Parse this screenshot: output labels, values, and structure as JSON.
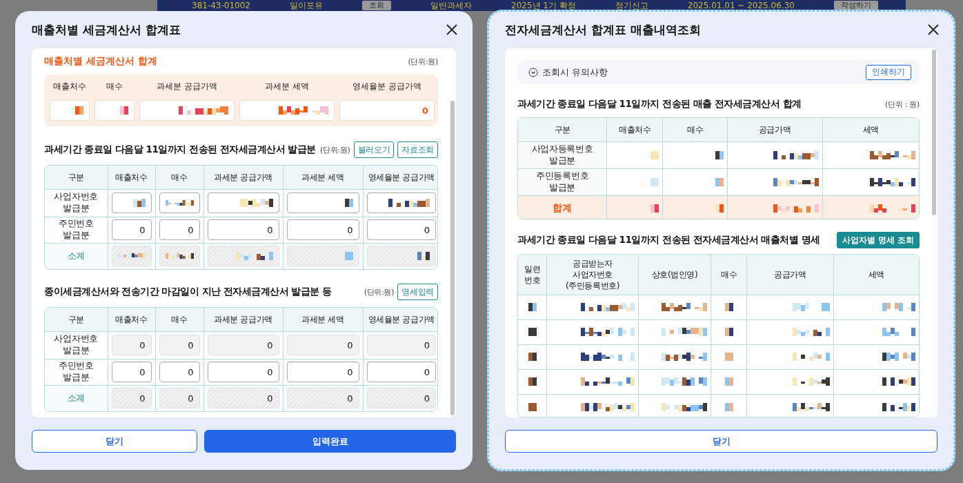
{
  "page_bar": [
    {
      "kind": "text",
      "text": "381-43-01002"
    },
    {
      "kind": "text",
      "text": "일이포유"
    },
    {
      "kind": "button",
      "text": "조회"
    },
    {
      "kind": "text",
      "text": "일반과세자"
    },
    {
      "kind": "text",
      "text": "2025년 1기 확정"
    },
    {
      "kind": "text",
      "text": "정기신고"
    },
    {
      "kind": "text",
      "text": "2025.01.01 ~ 2025.06.30"
    },
    {
      "kind": "button",
      "text": "작성하기"
    }
  ],
  "left_dialog": {
    "title": "매출처별 세금계산서 합계표",
    "summary": {
      "title": "매출처별 세금계산서 합계",
      "unit": "(단위:원)",
      "columns": [
        "매출처수",
        "매수",
        "과세분 공급가액",
        "과세분 세액",
        "영세율분 공급가액"
      ],
      "values": [
        {
          "masked": true
        },
        {
          "masked": true
        },
        {
          "masked": true
        },
        {
          "masked": true
        },
        {
          "masked": false,
          "text": "0"
        }
      ]
    },
    "sections": [
      {
        "title": "과세기간 종료일 다음달 11일까지 전송된 전자세금계산서 발급분",
        "unit": "(단위:원)",
        "buttons": [
          "불러오기",
          "자료조회"
        ],
        "columns": [
          "구분",
          "매출처수",
          "매수",
          "과세분 공급가액",
          "과세분 세액",
          "영세율분 공급가액"
        ],
        "rows": [
          {
            "kind": "entry",
            "cells": [
              {
                "kind": "label",
                "text": "사업자번호\n발급분"
              },
              {
                "kind": "input",
                "masked": true
              },
              {
                "kind": "input",
                "masked": true
              },
              {
                "kind": "input",
                "masked": true
              },
              {
                "kind": "input",
                "masked": true
              },
              {
                "kind": "input",
                "masked": true
              }
            ]
          },
          {
            "kind": "entry",
            "cells": [
              {
                "kind": "label",
                "text": "주민번호\n발급분"
              },
              {
                "kind": "input",
                "masked": false,
                "text": "0"
              },
              {
                "kind": "input",
                "masked": false,
                "text": "0"
              },
              {
                "kind": "input",
                "masked": false,
                "text": "0"
              },
              {
                "kind": "input",
                "masked": false,
                "text": "0"
              },
              {
                "kind": "input",
                "masked": false,
                "text": "0"
              }
            ]
          },
          {
            "kind": "subtotal",
            "cells": [
              {
                "kind": "label",
                "text": "소계"
              },
              {
                "kind": "hatched",
                "masked": true
              },
              {
                "kind": "hatched",
                "masked": true
              },
              {
                "kind": "hatched",
                "masked": true
              },
              {
                "kind": "hatched",
                "masked": true
              },
              {
                "kind": "hatched",
                "masked": true
              }
            ]
          }
        ]
      },
      {
        "title": "종이세금계산서와 전송기간 마감일이 지난 전자세금계산서 발급분 등",
        "unit": "(단위:원)",
        "buttons": [
          "명세입력"
        ],
        "columns": [
          "구분",
          "매출처수",
          "매수",
          "과세분 공급가액",
          "과세분 세액",
          "영세율분 공급가액"
        ],
        "rows": [
          {
            "kind": "entry",
            "cells": [
              {
                "kind": "label",
                "text": "사업자번호\n발급분"
              },
              {
                "kind": "readonly",
                "masked": false,
                "text": "0"
              },
              {
                "kind": "readonly",
                "masked": false,
                "text": "0"
              },
              {
                "kind": "readonly",
                "masked": false,
                "text": "0"
              },
              {
                "kind": "readonly",
                "masked": false,
                "text": "0"
              },
              {
                "kind": "readonly",
                "masked": false,
                "text": "0"
              }
            ]
          },
          {
            "kind": "entry",
            "cells": [
              {
                "kind": "label",
                "text": "주민번호\n발급분"
              },
              {
                "kind": "input",
                "masked": false,
                "text": "0"
              },
              {
                "kind": "input",
                "masked": false,
                "text": "0"
              },
              {
                "kind": "input",
                "masked": false,
                "text": "0"
              },
              {
                "kind": "input",
                "masked": false,
                "text": "0"
              },
              {
                "kind": "input",
                "masked": false,
                "text": "0"
              }
            ]
          },
          {
            "kind": "subtotal",
            "cells": [
              {
                "kind": "label",
                "text": "소계"
              },
              {
                "kind": "hatched",
                "masked": false,
                "text": "0"
              },
              {
                "kind": "hatched",
                "masked": false,
                "text": "0"
              },
              {
                "kind": "hatched",
                "masked": false,
                "text": "0"
              },
              {
                "kind": "hatched",
                "masked": false,
                "text": "0"
              },
              {
                "kind": "hatched",
                "masked": false,
                "text": "0"
              }
            ]
          }
        ]
      }
    ],
    "buttons": [
      {
        "kind": "secondary",
        "label": "닫기"
      },
      {
        "kind": "primary",
        "label": "입력완료"
      }
    ]
  },
  "right_dialog": {
    "title": "전자세금계산서 합계표 매출내역조회",
    "focused": true,
    "notice": {
      "label": "조회시 유의사항",
      "expanded": false,
      "button": "인쇄하기"
    },
    "summary": {
      "title": "과세기간 종료일 다음달 11일까지 전송된 매출 전자세금계산서 합계",
      "unit": "(단위 : 원)",
      "columns": [
        "구분",
        "매출처수",
        "매수",
        "공급가액",
        "세액"
      ],
      "rows": [
        {
          "kind": "entry",
          "cells": [
            {
              "kind": "label",
              "text": "사업자등록번호\n발급분"
            },
            {
              "kind": "value",
              "masked": true
            },
            {
              "kind": "value",
              "masked": true
            },
            {
              "kind": "value",
              "masked": true
            },
            {
              "kind": "value",
              "masked": true
            }
          ]
        },
        {
          "kind": "entry",
          "cells": [
            {
              "kind": "label",
              "text": "주민등록번호\n발급분"
            },
            {
              "kind": "value",
              "masked": true
            },
            {
              "kind": "value",
              "masked": true
            },
            {
              "kind": "value",
              "masked": true
            },
            {
              "kind": "value",
              "masked": true
            }
          ]
        },
        {
          "kind": "total",
          "cells": [
            {
              "kind": "label",
              "text": "합계"
            },
            {
              "kind": "value",
              "masked": true
            },
            {
              "kind": "value",
              "masked": true
            },
            {
              "kind": "value",
              "masked": true
            },
            {
              "kind": "value",
              "masked": true
            }
          ]
        }
      ]
    },
    "detail": {
      "title": "과세기간 종료일 다음달 11일까지 전송된 전자세금계산서 매출처별 명세",
      "button": "사업자별 명세 조회",
      "columns": [
        "일련\n번호",
        "공급받는자\n사업자번호\n(주민등록번호)",
        "상호(법인명)",
        "매수",
        "공급가액",
        "세액"
      ],
      "rows": [
        {
          "cells": [
            {
              "masked": true
            },
            {
              "masked": true
            },
            {
              "masked": true
            },
            {
              "masked": true
            },
            {
              "masked": true
            },
            {
              "masked": true
            }
          ]
        },
        {
          "cells": [
            {
              "masked": true
            },
            {
              "masked": true
            },
            {
              "masked": true
            },
            {
              "masked": true
            },
            {
              "masked": true
            },
            {
              "masked": true
            }
          ]
        },
        {
          "cells": [
            {
              "masked": true
            },
            {
              "masked": true
            },
            {
              "masked": true
            },
            {
              "masked": true
            },
            {
              "masked": true
            },
            {
              "masked": true
            }
          ]
        },
        {
          "cells": [
            {
              "masked": true
            },
            {
              "masked": true
            },
            {
              "masked": true
            },
            {
              "masked": true
            },
            {
              "masked": true
            },
            {
              "masked": true
            }
          ]
        },
        {
          "cells": [
            {
              "masked": true
            },
            {
              "masked": true
            },
            {
              "masked": true
            },
            {
              "masked": true
            },
            {
              "masked": true
            },
            {
              "masked": true
            }
          ]
        }
      ]
    },
    "buttons": [
      {
        "kind": "secondary",
        "label": "닫기"
      }
    ]
  }
}
